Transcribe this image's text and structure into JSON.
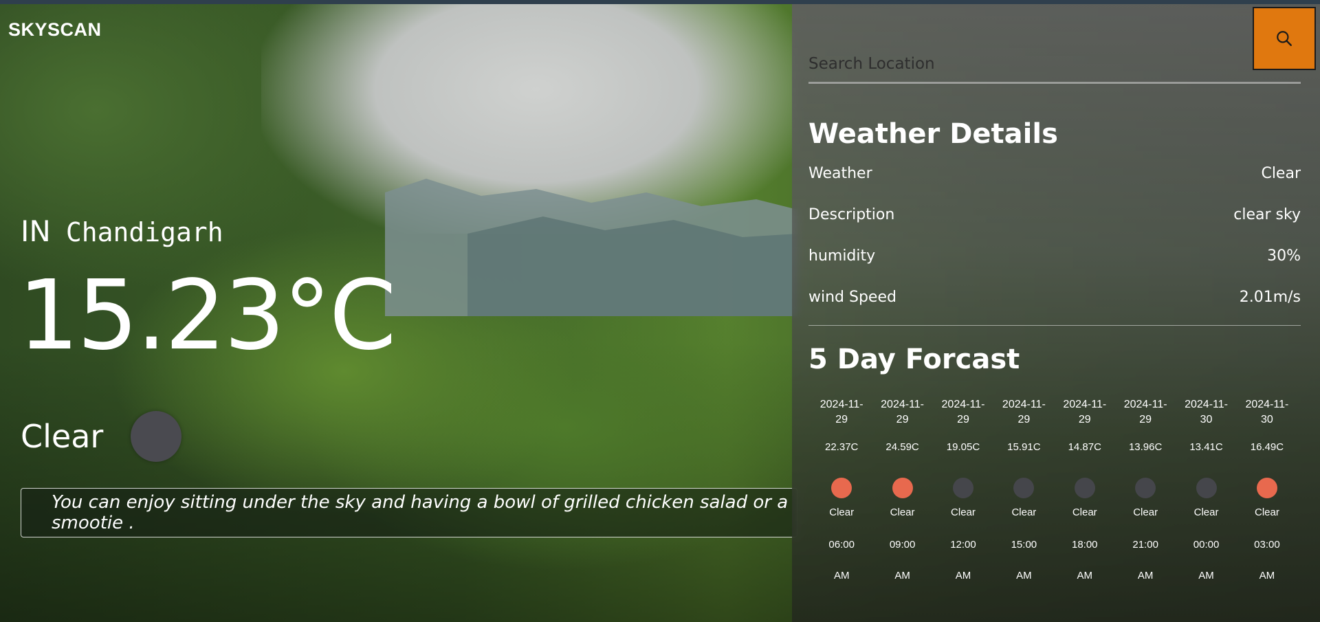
{
  "app": {
    "brand": "SKYSCAN"
  },
  "current": {
    "country": "IN",
    "city": "Chandigarh",
    "temperature": "15.23°C",
    "condition": "Clear",
    "suggestion": "You can enjoy sitting under the sky and having a bowl of grilled chicken salad or a smootie ."
  },
  "search": {
    "placeholder": "Search Location",
    "value": "",
    "icon": "search-icon",
    "button_color": "#e0780f"
  },
  "details": {
    "title": "Weather Details",
    "rows": [
      {
        "label": "Weather",
        "value": "Clear"
      },
      {
        "label": "Description",
        "value": "clear sky"
      },
      {
        "label": "humidity",
        "value": "30%"
      },
      {
        "label": "wind Speed",
        "value": "2.01m/s"
      }
    ]
  },
  "forecast": {
    "title": "5 Day Forcast",
    "items": [
      {
        "date": "2024-11-29",
        "temp": "22.37C",
        "desc": "Clear",
        "time": "06:00",
        "ampm": "AM",
        "icon_color": "#e8694e"
      },
      {
        "date": "2024-11-29",
        "temp": "24.59C",
        "desc": "Clear",
        "time": "09:00",
        "ampm": "AM",
        "icon_color": "#e8694e"
      },
      {
        "date": "2024-11-29",
        "temp": "19.05C",
        "desc": "Clear",
        "time": "12:00",
        "ampm": "AM",
        "icon_color": "#45464b"
      },
      {
        "date": "2024-11-29",
        "temp": "15.91C",
        "desc": "Clear",
        "time": "15:00",
        "ampm": "AM",
        "icon_color": "#45464b"
      },
      {
        "date": "2024-11-29",
        "temp": "14.87C",
        "desc": "Clear",
        "time": "18:00",
        "ampm": "AM",
        "icon_color": "#45464b"
      },
      {
        "date": "2024-11-29",
        "temp": "13.96C",
        "desc": "Clear",
        "time": "21:00",
        "ampm": "AM",
        "icon_color": "#45464b"
      },
      {
        "date": "2024-11-30",
        "temp": "13.41C",
        "desc": "Clear",
        "time": "00:00",
        "ampm": "AM",
        "icon_color": "#45464b"
      },
      {
        "date": "2024-11-30",
        "temp": "16.49C",
        "desc": "Clear",
        "time": "03:00",
        "ampm": "AM",
        "icon_color": "#e8694e"
      }
    ]
  }
}
